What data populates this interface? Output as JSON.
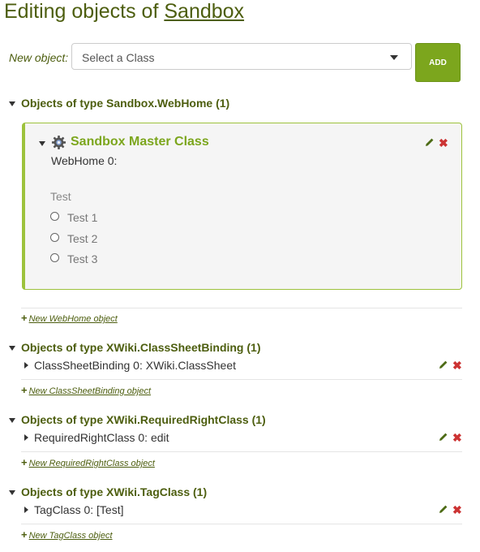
{
  "page": {
    "title_prefix": "Editing objects of",
    "title_link": "Sandbox"
  },
  "new_object": {
    "label": "New object:",
    "placeholder": "Select a Class",
    "add_label": "ADD"
  },
  "groups": [
    {
      "title": "Objects of type Sandbox.WebHome (1)",
      "object": {
        "class_title": "Sandbox Master Class",
        "label": "WebHome 0:",
        "property_name": "Test",
        "options": [
          "Test 1",
          "Test 2",
          "Test 3"
        ]
      },
      "new_link": "New WebHome object"
    },
    {
      "title": "Objects of type XWiki.ClassSheetBinding (1)",
      "entry": "ClassSheetBinding 0: XWiki.ClassSheet",
      "new_link": "New ClassSheetBinding object"
    },
    {
      "title": "Objects of type XWiki.RequiredRightClass (1)",
      "entry": "RequiredRightClass 0: edit",
      "new_link": "New RequiredRightClass object"
    },
    {
      "title": "Objects of type XWiki.TagClass (1)",
      "entry": "TagClass 0: [Test]",
      "new_link": "New TagClass object"
    }
  ],
  "icons": {
    "gear": "gear-icon",
    "edit": "pencil-icon",
    "delete": "delete-x-icon",
    "add": "plus-icon"
  },
  "colors": {
    "title": "#4d5e0f",
    "accent": "#7ca61d",
    "delete": "#cc3333"
  }
}
